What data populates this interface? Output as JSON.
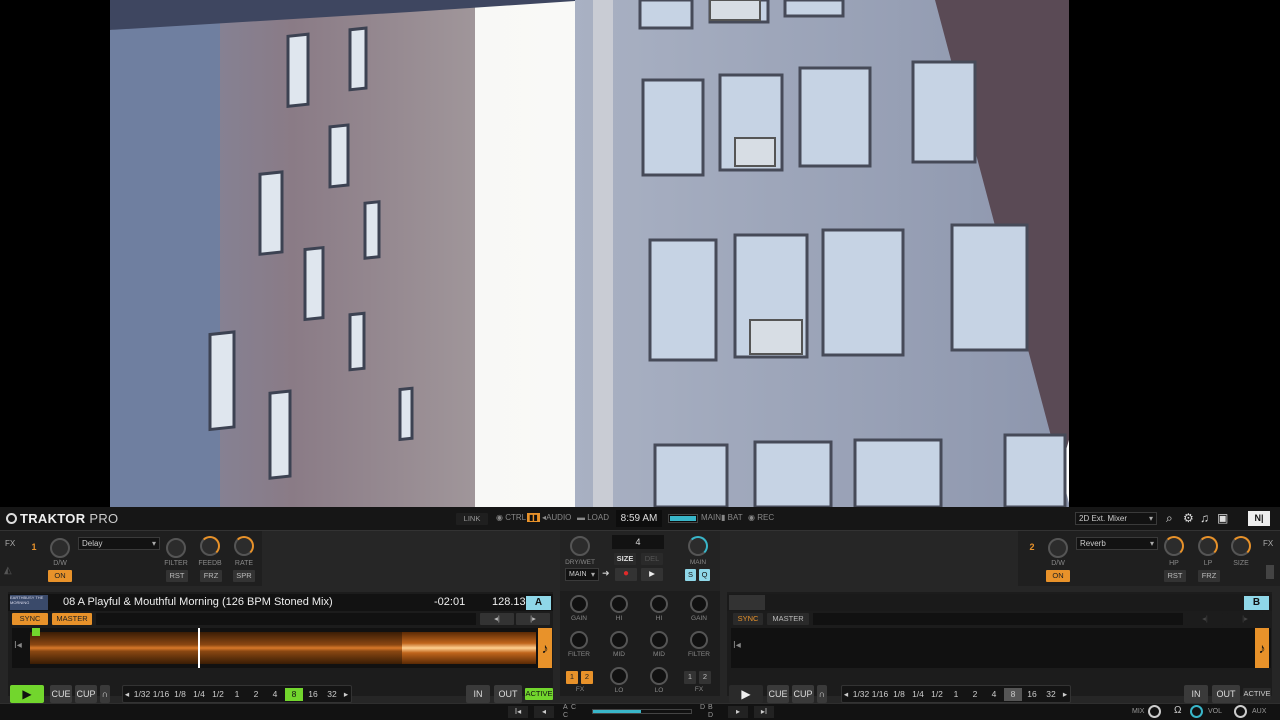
{
  "app": {
    "logo": "TRAKTOR",
    "logo_suffix": "PRO"
  },
  "status": {
    "link": "LINK",
    "ctrl": "CTRL",
    "audio": "AUDIO",
    "load": "LOAD",
    "clock": "8:59 AM",
    "main": "MAIN",
    "bat": "BAT",
    "rec": "REC",
    "layout": "2D Ext. Mixer"
  },
  "fx1": {
    "side": "FX",
    "num": "1",
    "effect": "Delay",
    "knob1": "D/W",
    "on": "ON",
    "knobs": [
      "FILTER",
      "FEEDB",
      "RATE"
    ],
    "btns": [
      "RST",
      "FRZ",
      "SPR"
    ]
  },
  "fx2": {
    "side": "FX",
    "num": "2",
    "effect": "Reverb",
    "knob1": "D/W",
    "on": "ON",
    "knobs": [
      "HP",
      "LP",
      "SIZE"
    ],
    "btns": [
      "RST",
      "FRZ"
    ]
  },
  "master": {
    "drywet": "DRY/WET",
    "size_val": "4",
    "size": "SIZE",
    "del": "DEL",
    "main_sel": "MAIN",
    "main": "MAIN",
    "s": "S",
    "q": "Q"
  },
  "deckA": {
    "letter": "A",
    "cover": "EARTHBUSY THE MORNING",
    "title": "08 A Playful & Mouthful Morning (126 BPM Stoned Mix)",
    "time": "-02:01",
    "bpm": "128.13",
    "sync": "SYNC",
    "master": "MASTER",
    "cue": "CUE",
    "cup": "CUP",
    "in": "IN",
    "out": "OUT",
    "active": "ACTIVE",
    "loops": [
      "1/32",
      "1/16",
      "1/8",
      "1/4",
      "1/2",
      "1",
      "2",
      "4",
      "8",
      "16",
      "32"
    ],
    "active_loop": "8"
  },
  "deckB": {
    "letter": "B",
    "sync": "SYNC",
    "master": "MASTER",
    "cue": "CUE",
    "cup": "CUP",
    "in": "IN",
    "out": "OUT",
    "active": "ACTIVE",
    "loops": [
      "1/32",
      "1/16",
      "1/8",
      "1/4",
      "1/2",
      "1",
      "2",
      "4",
      "8",
      "16",
      "32"
    ],
    "active_loop": "8"
  },
  "mixer": {
    "gain": "GAIN",
    "hi": "HI",
    "mid": "MID",
    "lo": "LO",
    "filter": "FILTER",
    "fx": "FX",
    "fx1": "1",
    "fx2": "2"
  },
  "bottom": {
    "mix": "MIX",
    "vol": "VOL",
    "aux": "AUX",
    "a": "A",
    "b": "B",
    "c": "C",
    "d": "D"
  },
  "colors": {
    "orange": "#e8922a",
    "green": "#72d62d",
    "cyan": "#8fd7e8"
  }
}
